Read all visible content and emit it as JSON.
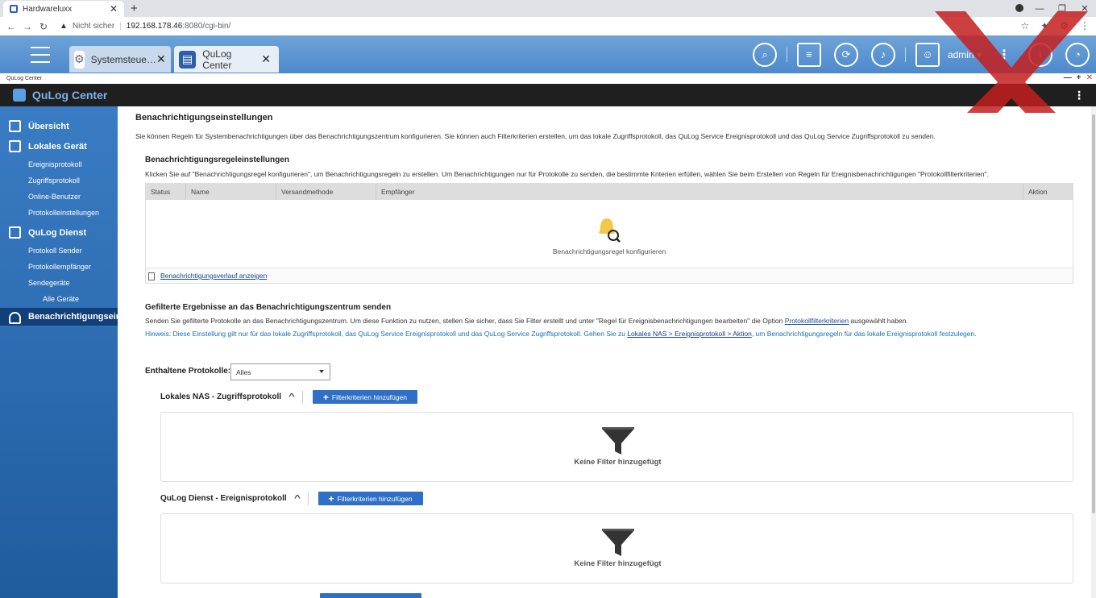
{
  "browser": {
    "tab_title": "Hardwareluxx",
    "tab_close": "✕",
    "new_tab": "+",
    "not_secure": "Nicht sicher",
    "url_host": "192.168.178.46",
    "url_path": ":8080/cgi-bin/",
    "win_min": "—",
    "win_max": "❐",
    "win_close": "✕"
  },
  "qnap": {
    "tabs": [
      {
        "label": "Systemsteue…",
        "icon": "gear-icon"
      },
      {
        "label": "QuLog Center",
        "icon": "qulog-icon"
      }
    ],
    "user": "admin ▾"
  },
  "window": {
    "title": "QuLog Center",
    "minimize": "—",
    "maximize": "+",
    "close": "✕"
  },
  "app": {
    "title": "QuLog Center",
    "menu": "⋮"
  },
  "sidebar": {
    "overview": "Übersicht",
    "local_device": "Lokales Gerät",
    "local_items": [
      "Ereignisprotokoll",
      "Zugriffsprotokoll",
      "Online-Benutzer",
      "Protokolleinstellungen"
    ],
    "service": "QuLog Dienst",
    "service_items": [
      "Protokoll Sender",
      "Protokollempfänger",
      "Sendegeräte"
    ],
    "all_devices": "Alle Geräte",
    "notifications": "Benachrichtigungseins"
  },
  "main": {
    "title": "Benachrichtigungseinstellungen",
    "description": "Sie können Regeln für Systembenachrichtigungen über das Benachrichtigungszentrum konfigurieren. Sie können auch Filterkriterien erstellen, um das lokale Zugriffsprotokoll, das QuLog Service Ereignisprotokoll und das QuLog Service Zugriffsprotokoll zu senden.",
    "rules_title": "Benachrichtigungsregeleinstellungen",
    "rules_desc": "Klicken Sie auf \"Benachrichtigungsregel konfigurieren\", um Benachrichtigungsregeln zu erstellen. Um Benachrichtigungen nur für Protokolle zu senden, die bestimmte Kriterien erfüllen, wählen Sie beim Erstellen von Regeln für Ereignisbenachrichtigungen \"Protokollfilterkriterien\".",
    "table_headers": [
      "Status",
      "Name",
      "Versandmethode",
      "Empfänger",
      "Aktion"
    ],
    "configure_rule": "Benachrichtigungsregel konfigurieren",
    "history_link": "Benachrichtigungsverlauf anzeigen",
    "filtered_title": "Gefilterte Ergebnisse an das Benachrichtigungszentrum senden",
    "filtered_desc_pre": "Senden Sie gefilterte Protokolle an das Benachrichtigungszentrum. Um diese Funktion zu nutzen, stellen Sie sicher, dass Sie Filter erstellt und unter \"Regel für Ereignisbenachrichtigungen bearbeiten\" die Option ",
    "filtered_desc_link": "Protokollfilterkriterien",
    "filtered_desc_post": " ausgewählt haben.",
    "hint_pre": "Hinweis: Diese Einstellung gilt nur für das lokale Zugriffsprotokoll, das QuLog Service Ereignisprotokoll und das QuLog Service Zugriffsprotokoll. Gehen Sie zu ",
    "hint_link": "Lokales NAS > Ereignisprotokoll > Aktion",
    "hint_post": ", um Benachrichtigungsregeln für das lokale Ereignisprotokoll festzulegen.",
    "protocols_label": "Enthaltene Protokolle:",
    "protocols_value": "Alles",
    "sections": [
      {
        "title": "Lokales NAS - Zugriffsprotokoll",
        "button": "Filterkriterien hinzufügen",
        "empty": "Keine Filter hinzugefügt"
      },
      {
        "title": "QuLog Dienst - Ereignisprotokoll",
        "button": "Filterkriterien hinzufügen",
        "empty": "Keine Filter hinzugefügt"
      }
    ]
  },
  "colors": {
    "sidebar_top": "#3a7cc4",
    "sidebar_active": "#123f77",
    "accent_button": "#2f70c6",
    "app_header": "#1f1f1f",
    "watermark": "#c41e1e"
  }
}
